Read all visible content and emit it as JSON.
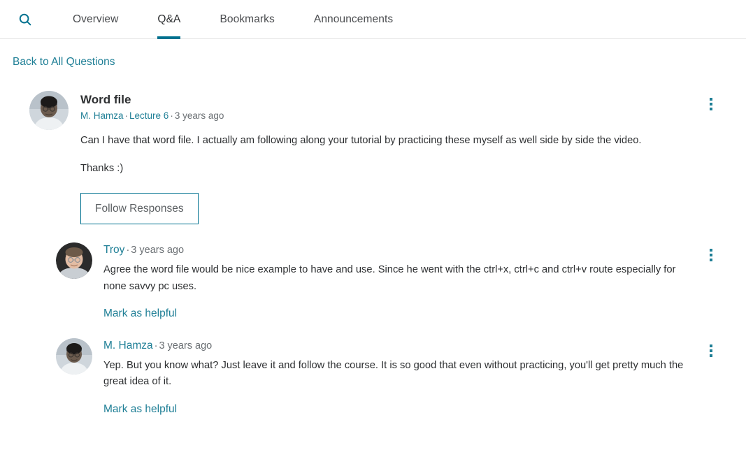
{
  "nav": {
    "search_icon": "search-icon",
    "tabs": [
      {
        "label": "Overview",
        "active": false
      },
      {
        "label": "Q&A",
        "active": true
      },
      {
        "label": "Bookmarks",
        "active": false
      },
      {
        "label": "Announcements",
        "active": false
      }
    ],
    "active_tab": "Q&A",
    "accent_color": "#00718f"
  },
  "back_link": {
    "label": "Back to All Questions"
  },
  "question": {
    "title": "Word file",
    "author": "M. Hamza",
    "lecture": "Lecture 6",
    "time": "3 years ago",
    "separator": "·",
    "paragraphs": [
      "Can I have that word file. I actually am following along your tutorial by practicing these myself as well side by side the video.",
      "Thanks :)"
    ],
    "follow_button": "Follow Responses",
    "menu_icon": "kebab-menu-icon"
  },
  "replies": [
    {
      "author": "Troy",
      "time": "3 years ago",
      "separator": "·",
      "text": "Agree the word file would be nice example to have and use. Since he went with the ctrl+x, ctrl+c and ctrl+v route especially for none savvy pc uses.",
      "helpful_label": "Mark as helpful",
      "menu_icon": "kebab-menu-icon"
    },
    {
      "author": "M. Hamza",
      "time": "3 years ago",
      "separator": "·",
      "text": "Yep. But you know what? Just leave it and follow the course. It is so good that even without practicing, you'll get pretty much the great idea of it.",
      "helpful_label": "Mark as helpful",
      "menu_icon": "kebab-menu-icon"
    }
  ],
  "colors": {
    "link": "#1f7f96",
    "accent": "#00718f",
    "text": "#2d2f31",
    "muted": "#6a6f73",
    "border": "#e3e3e3"
  }
}
